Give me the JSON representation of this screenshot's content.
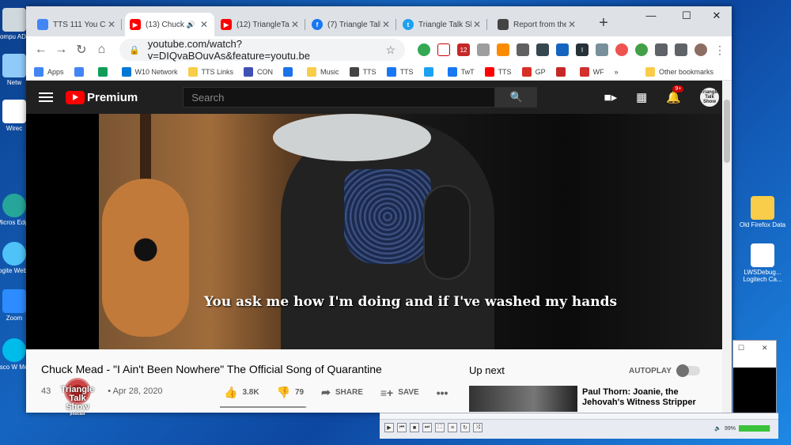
{
  "desktop": {
    "left_icons": [
      "Compu\nADMI",
      "Netw",
      "Wirec",
      "Micros\nEdge",
      "Logite\nWebca",
      "Zoom",
      "Cisco W\nMeeti"
    ],
    "right_icons": [
      "Old Firefox\nData",
      "LWSDebug...\nLogitech Ca..."
    ]
  },
  "browser": {
    "tabs": [
      {
        "title": "TTS 111 You Can't",
        "favicon": "docs-icon",
        "color": "#4285f4"
      },
      {
        "title": "(13) Chuck M",
        "favicon": "youtube-icon",
        "color": "#ff0000",
        "audio": "🔊"
      },
      {
        "title": "(12) TriangleTalkSh",
        "favicon": "youtube-icon",
        "color": "#ff0000"
      },
      {
        "title": "(7) Triangle Talk Sh",
        "favicon": "facebook-icon",
        "color": "#1877f2"
      },
      {
        "title": "Triangle Talk Show",
        "favicon": "twitter-icon",
        "color": "#1da1f2"
      },
      {
        "title": "Report from the T",
        "favicon": "tts-icon",
        "color": "#444444"
      }
    ],
    "address": "youtube.com/watch?v=DIQvaBOuvAs&feature=youtu.be",
    "bookmarks": [
      {
        "label": "Apps",
        "icon": "apps-grid-icon",
        "color": "#4285f4"
      },
      {
        "label": "",
        "icon": "google-icon",
        "color": "#4285f4"
      },
      {
        "label": "",
        "icon": "drive-icon",
        "color": "#0f9d58"
      },
      {
        "label": "W10 Network",
        "icon": "windows-icon",
        "color": "#0078d4"
      },
      {
        "label": "TTS Links",
        "icon": "folder-icon",
        "color": "#f9cc4a"
      },
      {
        "label": "CON",
        "icon": "con-icon",
        "color": "#3f51b5"
      },
      {
        "label": "",
        "icon": "calendar-icon",
        "color": "#1a73e8"
      },
      {
        "label": "Music",
        "icon": "folder-icon",
        "color": "#f9cc4a"
      },
      {
        "label": "TTS",
        "icon": "tts-icon",
        "color": "#444444"
      },
      {
        "label": "TTS",
        "icon": "facebook-icon",
        "color": "#1877f2"
      },
      {
        "label": "",
        "icon": "twitter-icon",
        "color": "#1da1f2"
      },
      {
        "label": "TwT",
        "icon": "facebook-icon",
        "color": "#1877f2"
      },
      {
        "label": "TTS",
        "icon": "youtube-icon",
        "color": "#ff0000"
      },
      {
        "label": "GP",
        "icon": "gmail-icon",
        "color": "#d93025"
      },
      {
        "label": "",
        "icon": "tool-icon",
        "color": "#c62828"
      },
      {
        "label": "WF",
        "icon": "wf-icon",
        "color": "#d32f2f"
      },
      {
        "label": "»",
        "icon": "",
        "color": ""
      },
      {
        "label": "Other bookmarks",
        "icon": "folder-icon",
        "color": "#f9cc4a"
      }
    ]
  },
  "youtube": {
    "brand": "Premium",
    "search_placeholder": "Search",
    "notification_count": "9+",
    "avatar_text": "Triangle Talk Show",
    "subtitle": "You ask me how I'm doing and if I've washed my hands",
    "video_title": "Chuck Mead - \"I Ain't Been Nowhere\" The Official Song of Quarantine",
    "views_partial": "43",
    "date": "Apr 28, 2020",
    "likes": "3.8K",
    "dislikes": "79",
    "share_label": "SHARE",
    "save_label": "SAVE",
    "like_ratio": 0.98,
    "up_next": "Up next",
    "autoplay": "AUTOPLAY",
    "next_video_title": "Paul Thorn: Joanie, the Jehovah's Witness Stripper"
  },
  "watermark": {
    "lines": [
      "Triangle",
      "Talk",
      "Show"
    ],
    "sub": "podcast"
  },
  "media_player": {
    "volume": "99%"
  }
}
